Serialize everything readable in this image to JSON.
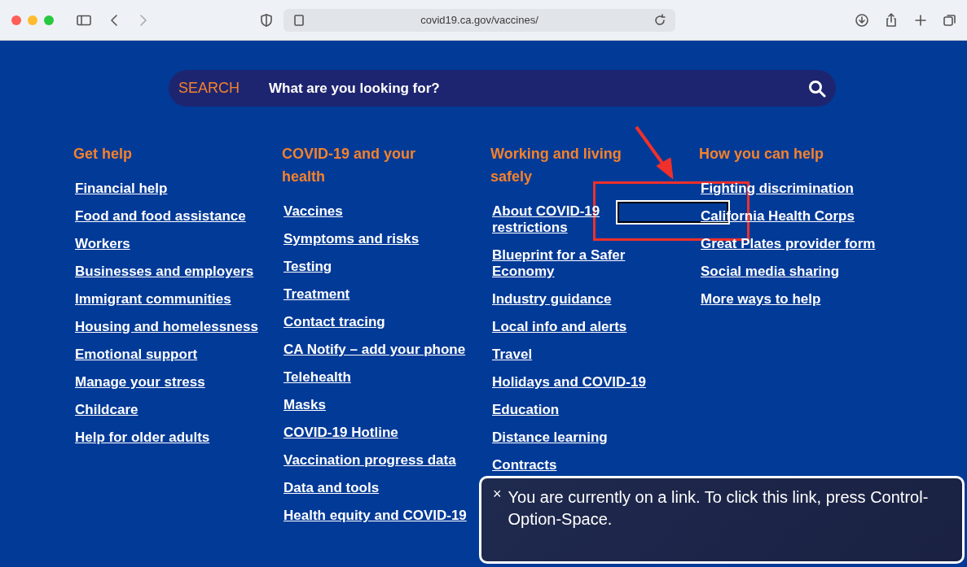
{
  "browser": {
    "url": "covid19.ca.gov/vaccines/"
  },
  "search": {
    "label": "SEARCH",
    "placeholder": "What are you looking for?"
  },
  "columns": [
    {
      "heading": "Get help",
      "links": [
        "Financial help",
        "Food and food assistance",
        "Workers",
        "Businesses and employers",
        "Immigrant communities",
        "Housing and homelessness",
        "Emotional support",
        "Manage your stress",
        "Childcare",
        "Help for older adults"
      ]
    },
    {
      "heading": "COVID-19 and your health",
      "links": [
        "Vaccines",
        "Symptoms and risks",
        "Testing",
        "Treatment",
        "Contact tracing",
        "CA Notify – add your phone",
        "Telehealth",
        "Masks",
        "COVID-19 Hotline",
        "Vaccination progress data",
        "Data and tools",
        "Health equity and COVID-19"
      ]
    },
    {
      "heading": "Working and living safely",
      "links": [
        "About COVID-19 restrictions",
        "Blueprint for a Safer Economy",
        "Industry guidance",
        "Local info and alerts",
        "Travel",
        "Holidays and COVID-19",
        "Education",
        "Distance learning",
        "Contracts"
      ]
    },
    {
      "heading": "How you can help",
      "links": [
        "Fighting discrimination",
        "California Health Corps",
        "Great Plates provider form",
        "Social media sharing",
        "More ways to help"
      ]
    }
  ],
  "caption": {
    "close": "×",
    "text": "You are currently on a link. To click this link, press Control-Option-Space."
  }
}
